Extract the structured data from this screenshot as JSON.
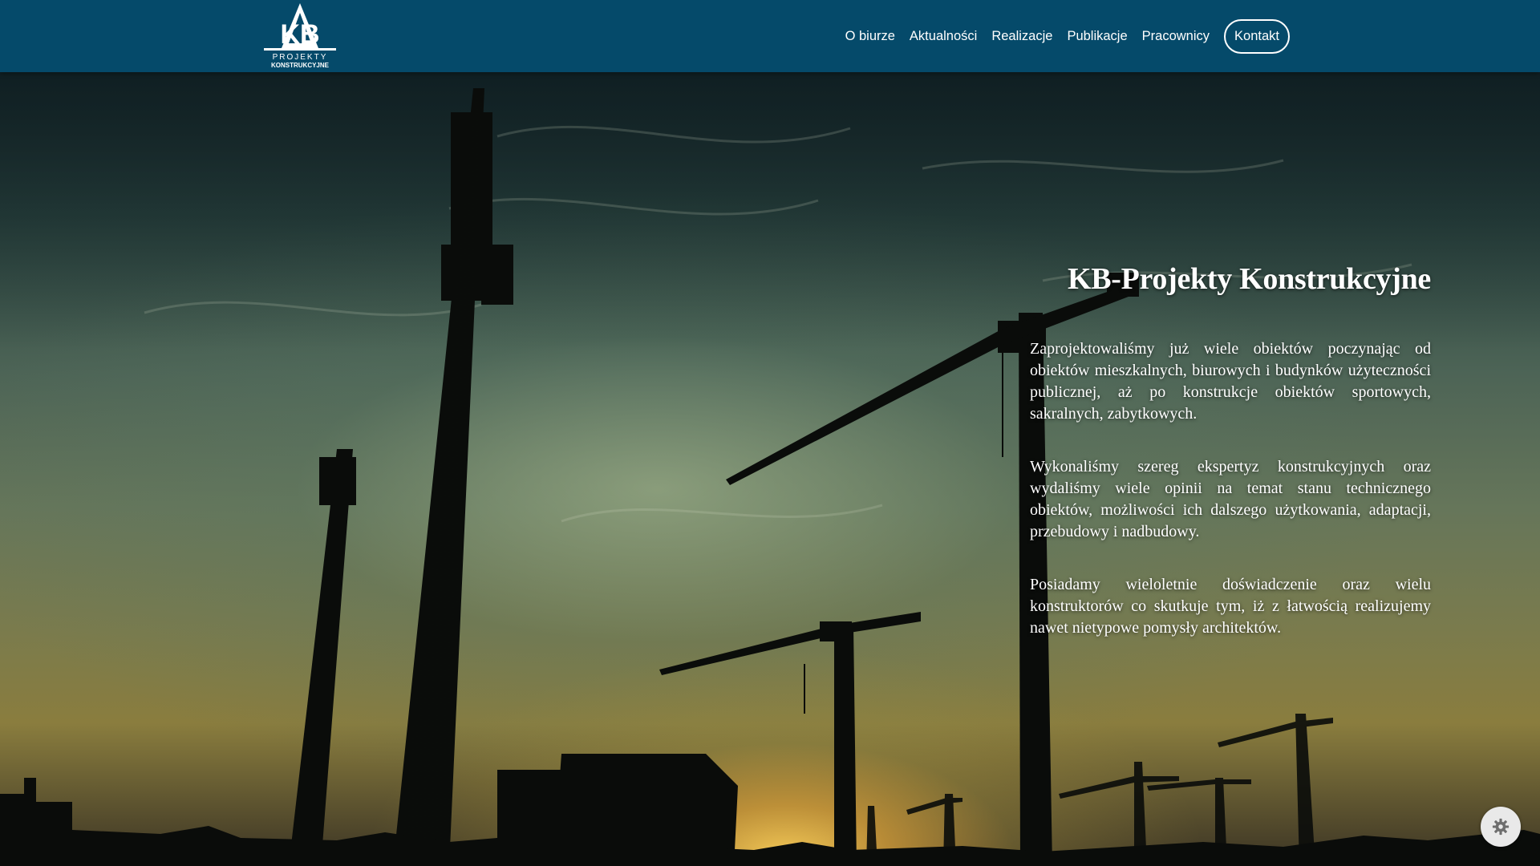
{
  "header": {
    "logo": {
      "mark": "KB",
      "line1": "PROJEKTY",
      "line2": "KONSTRUKCYJNE"
    },
    "nav": [
      {
        "label": "O biurze"
      },
      {
        "label": "Aktualności"
      },
      {
        "label": "Realizacje"
      },
      {
        "label": "Publikacje"
      },
      {
        "label": "Pracownicy"
      }
    ],
    "contact_label": "Kontakt"
  },
  "hero": {
    "title": "KB-Projekty Konstrukcyjne",
    "paragraphs": [
      "Zaprojektowaliśmy już wiele obiektów poczynając od obiektów mieszkalnych, biurowych i budynków użyteczności publicznej, aż po konstrukcje obiektów sportowych, sakralnych, zabytkowych.",
      "Wykonaliśmy szereg ekspertyz konstrukcyjnych oraz wydaliśmy wiele opinii na temat stanu technicznego obiektów, możliwości ich dalszego użytkowania, adaptacji, przebudowy i nadbudowy.",
      "Posiadamy wieloletnie doświadczenie oraz wielu konstruktorów co skutkuje tym, iż z łatwością realizujemy nawet nietypowe pomysły architektów."
    ],
    "background": "construction-cranes-sunset-photo"
  },
  "widgets": {
    "settings_icon": "gear-icon"
  },
  "colors": {
    "header_bg": "#054a6a",
    "text": "#ffffff"
  }
}
